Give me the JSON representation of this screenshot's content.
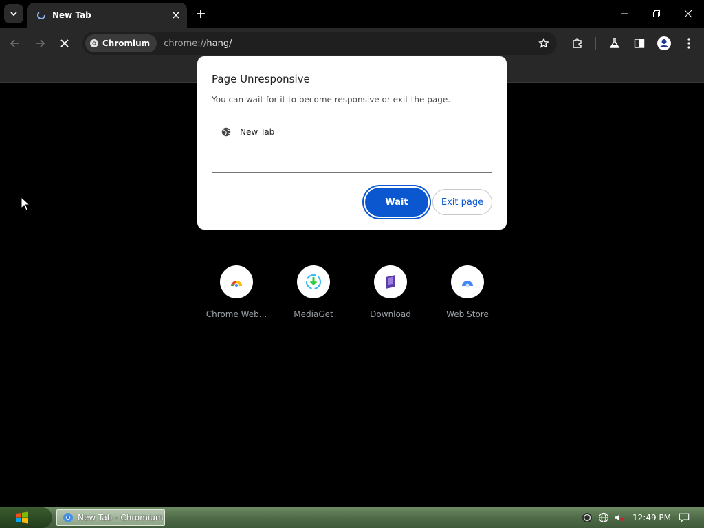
{
  "tab": {
    "title": "New Tab"
  },
  "toolbar": {
    "site_chip": "Chromium",
    "url_prefix": "chrome://",
    "url_rest": "hang/"
  },
  "dialog": {
    "title": "Page Unresponsive",
    "message": "You can wait for it to become responsive or exit the page.",
    "list_items": [
      "New Tab"
    ],
    "wait_label": "Wait",
    "exit_label": "Exit page"
  },
  "shortcuts": [
    {
      "label": "Chrome Web...",
      "icon": "chrome-web-store-icon"
    },
    {
      "label": "MediaGet",
      "icon": "mediaget-icon"
    },
    {
      "label": "Download",
      "icon": "download-icon"
    },
    {
      "label": "Web Store",
      "icon": "web-store-icon"
    }
  ],
  "taskbar": {
    "task_label": "New Tab - Chromium",
    "clock": "12:49 PM"
  },
  "colors": {
    "accent": "#0b57d0",
    "toolbar_bg": "#282828",
    "dialog_bg": "#ffffff"
  }
}
